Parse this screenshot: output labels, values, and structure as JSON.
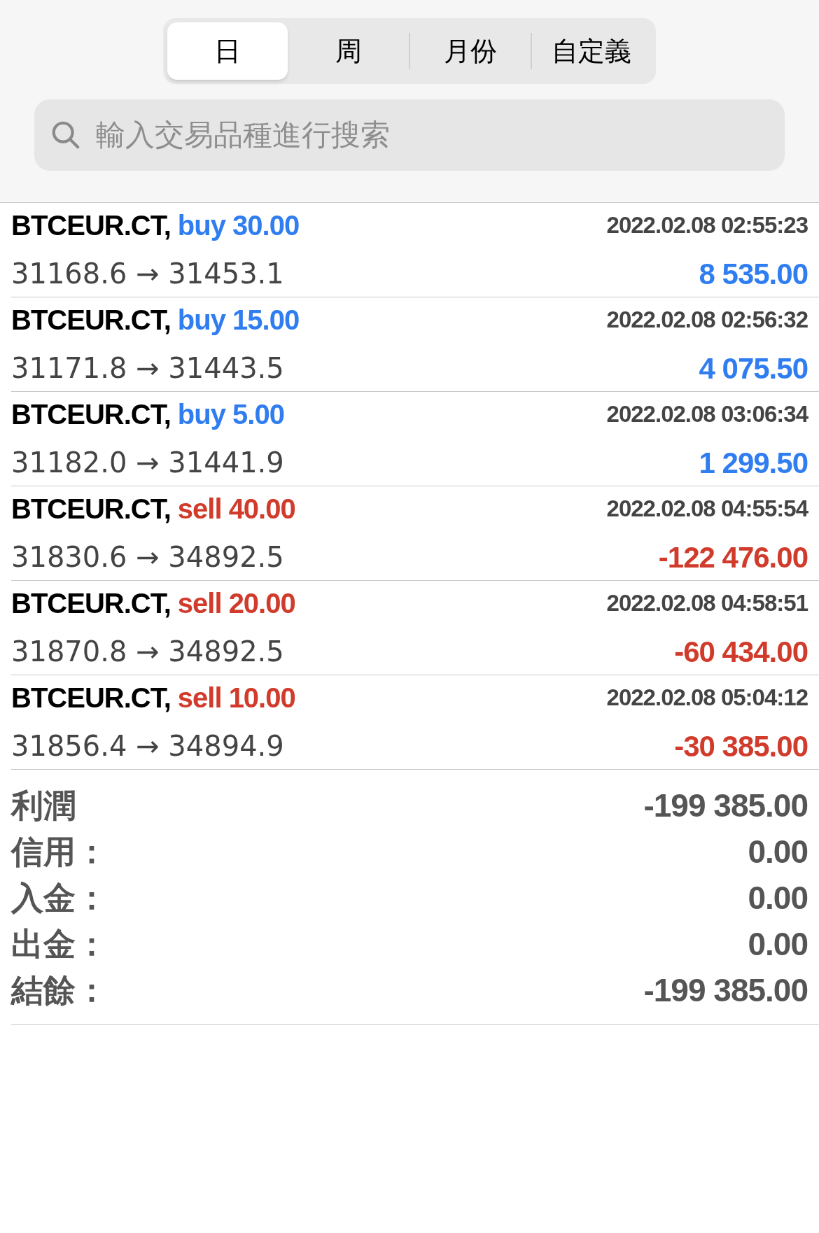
{
  "period_tabs": [
    {
      "label": "日",
      "selected": true
    },
    {
      "label": "周",
      "selected": false
    },
    {
      "label": "月份",
      "selected": false
    },
    {
      "label": "自定義",
      "selected": false
    }
  ],
  "search": {
    "placeholder": "輸入交易品種進行搜索"
  },
  "trades": [
    {
      "symbol": "BTCEUR.CT,",
      "kind": "buy",
      "side": "buy",
      "volume": "30.00",
      "prices": "31168.6 → 31453.1",
      "time": "2022.02.08 02:55:23",
      "profit": "8 535.00"
    },
    {
      "symbol": "BTCEUR.CT,",
      "kind": "buy",
      "side": "buy",
      "volume": "15.00",
      "prices": "31171.8 → 31443.5",
      "time": "2022.02.08 02:56:32",
      "profit": "4 075.50"
    },
    {
      "symbol": "BTCEUR.CT,",
      "kind": "buy",
      "side": "buy",
      "volume": "5.00",
      "prices": "31182.0 → 31441.9",
      "time": "2022.02.08 03:06:34",
      "profit": "1 299.50"
    },
    {
      "symbol": "BTCEUR.CT,",
      "kind": "sell",
      "side": "sell",
      "volume": "40.00",
      "prices": "31830.6 → 34892.5",
      "time": "2022.02.08 04:55:54",
      "profit": "-122 476.00"
    },
    {
      "symbol": "BTCEUR.CT,",
      "kind": "sell",
      "side": "sell",
      "volume": "20.00",
      "prices": "31870.8 → 34892.5",
      "time": "2022.02.08 04:58:51",
      "profit": "-60 434.00"
    },
    {
      "symbol": "BTCEUR.CT,",
      "kind": "sell",
      "side": "sell",
      "volume": "10.00",
      "prices": "31856.4 → 34894.9",
      "time": "2022.02.08 05:04:12",
      "profit": "-30 385.00"
    }
  ],
  "summary": [
    {
      "label": "利潤",
      "value": "-199 385.00"
    },
    {
      "label": "信用：",
      "value": "0.00"
    },
    {
      "label": "入金：",
      "value": "0.00"
    },
    {
      "label": "出金：",
      "value": "0.00"
    },
    {
      "label": "結餘：",
      "value": "-199 385.00"
    }
  ]
}
